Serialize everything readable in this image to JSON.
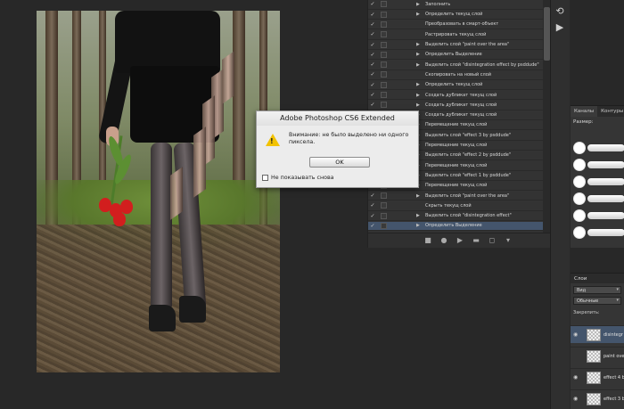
{
  "actions": [
    {
      "label": "Заполнить",
      "checked": true,
      "expand": true,
      "selected": false
    },
    {
      "label": "Определить текущ слой",
      "checked": true,
      "expand": true,
      "selected": false
    },
    {
      "label": "Преобразовать в смарт-объект",
      "checked": true,
      "expand": false,
      "selected": false
    },
    {
      "label": "Растрировать текущ слой",
      "checked": true,
      "expand": false,
      "selected": false
    },
    {
      "label": "Выделить слой \"paint over the area\"",
      "checked": true,
      "expand": true,
      "selected": false
    },
    {
      "label": "Определить Выделение",
      "checked": true,
      "expand": true,
      "selected": false
    },
    {
      "label": "Выделить слой \"disintegration effect by psddude\"",
      "checked": true,
      "expand": true,
      "selected": false
    },
    {
      "label": "Скопировать на новый слой",
      "checked": true,
      "expand": false,
      "selected": false
    },
    {
      "label": "Определить текущ слой",
      "checked": true,
      "expand": true,
      "selected": false
    },
    {
      "label": "Создать дубликат текущ слой",
      "checked": true,
      "expand": true,
      "selected": false
    },
    {
      "label": "Создать дубликат текущ слой",
      "checked": true,
      "expand": true,
      "selected": false
    },
    {
      "label": "Создать дубликат текущ слой",
      "checked": true,
      "expand": true,
      "selected": false
    },
    {
      "label": "Перемещение текущ слой",
      "checked": true,
      "expand": true,
      "selected": false
    },
    {
      "label": "Выделить слой \"effect 3 by psddude\"",
      "checked": true,
      "expand": true,
      "selected": false
    },
    {
      "label": "Перемещение текущ слой",
      "checked": true,
      "expand": true,
      "selected": false
    },
    {
      "label": "Выделить слой \"effect 2 by psddude\"",
      "checked": true,
      "expand": true,
      "selected": false
    },
    {
      "label": "Перемещение текущ слой",
      "checked": true,
      "expand": true,
      "selected": false
    },
    {
      "label": "Выделить слой \"effect 1 by psddude\"",
      "checked": true,
      "expand": true,
      "selected": false
    },
    {
      "label": "Перемещение текущ слой",
      "checked": true,
      "expand": true,
      "selected": false
    },
    {
      "label": "Выделить слой \"paint over the area\"",
      "checked": true,
      "expand": true,
      "selected": false
    },
    {
      "label": "Скрыть текущ слой",
      "checked": true,
      "expand": false,
      "selected": false
    },
    {
      "label": "Выделить слой \"disintegration effect\"",
      "checked": true,
      "expand": true,
      "selected": false
    },
    {
      "label": "Определить Выделение",
      "checked": true,
      "expand": true,
      "selected": true
    }
  ],
  "actions_toolbar": [
    "stop-icon",
    "record-icon",
    "play-icon",
    "folder-icon",
    "new-action-icon",
    "trash-icon"
  ],
  "brushes": {
    "tabs": [
      "Каналы",
      "Контуры"
    ],
    "size_label": "Размер:",
    "rows": 6
  },
  "layers": {
    "tab": "Слои",
    "filter": "Вид",
    "blend": "Обычные",
    "lock_label": "Закрепить:",
    "items": [
      {
        "name": "disintegr",
        "visible": true,
        "selected": true
      },
      {
        "name": "paint ove",
        "visible": false,
        "selected": false
      },
      {
        "name": "effect 4 b",
        "visible": true,
        "selected": false
      },
      {
        "name": "effect 3 b",
        "visible": true,
        "selected": false
      }
    ]
  },
  "dialog": {
    "title": "Adobe Photoshop CS6 Extended",
    "message": "Внимание: не было выделено ни одного пиксела.",
    "ok_label": "OK",
    "dont_show_label": "Не показывать снова"
  },
  "colors": {
    "workspace": "#282828",
    "panel": "#333333",
    "selection": "#44556c",
    "warning": "#f2c200"
  }
}
